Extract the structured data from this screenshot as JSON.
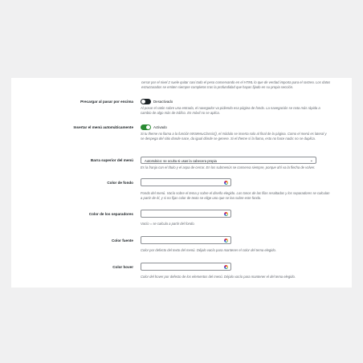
{
  "intro_text": "cerrar por el nivel 2 suele quitar casi todo el peso conservando en el HTML lo que de verdad importa para el rastreo. Los datos estructurados se emiten siempre completos tras la profundidad que hayas fijado en su propia sección.",
  "settings": {
    "prefetch": {
      "label": "Precargar al pasar por encima",
      "state": "Desactivado",
      "description": "Al posar el ratón sobre una entrada, el navegador va pidiendo esa página de fondo. La navegación se nota más rápida a cambio de algo más de tráfico. En móvil no se aplica."
    },
    "auto_insert": {
      "label": "Insertar el menú automáticamente",
      "state": "Activado",
      "description": "Si tu theme no llama a la función WcMenuClassic(), el módulo se inserta solo al final de la página. Como el menú es lateral y se despega del sitio donde nace, da igual dónde se genere. Si el theme sí la llama, esto no hace nada: no se duplica."
    },
    "top_bar": {
      "label": "Barra superior del menú",
      "value": "Automático: se oculta si usas la cabecera propia",
      "description": "Es la franja con el título y el aspa de cerrar. En los submenús se conserva siempre, porque ahí va la flecha de volver."
    },
    "bg_color": {
      "label": "Color de fondo",
      "value": "",
      "description": "Fondo del menú. Vacío sobre el tema y sobre el diseño elegido. Los tonos de las filas resaltadas y los separadores se calculan a partir de él, y si no fijas color de texto se elige uno que se lea sobre este fondo."
    },
    "sep_color": {
      "label": "Color de los separadores",
      "value": "",
      "description": "Vacío = se calcula a partir del fondo."
    },
    "font_color": {
      "label": "Color fuente",
      "value": "",
      "description": "Color por defecto del texto del menú. Déjalo vacío para mantener el color del tema elegido."
    },
    "hover_color": {
      "label": "Color hover",
      "value": "",
      "description": "Color del hover por defecto de los elementos del menú. Déjalo vacío para mantener el del tema elegido."
    }
  },
  "colors": {
    "toggle_on": "#2a8a32",
    "toggle_off": "#1d2327",
    "page_bg": "#f0f0f1",
    "panel_bg": "#ffffff"
  }
}
